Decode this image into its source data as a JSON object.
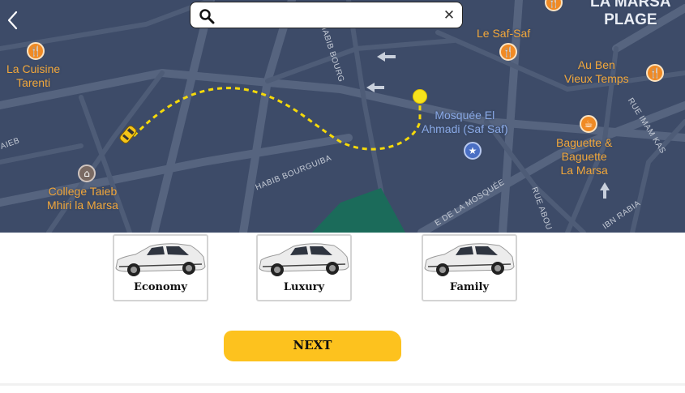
{
  "search": {
    "placeholder": "",
    "value": ""
  },
  "map": {
    "places": [
      {
        "id": "la-marsa-plage",
        "text": "LA MARSA\nPLAGE"
      },
      {
        "id": "le-saf-saf",
        "text": "Le Saf-Saf"
      },
      {
        "id": "la-cuisine-tarenti",
        "text": "La Cuisine\nTarenti"
      },
      {
        "id": "au-ben-vieux-temps",
        "text": "Au Ben\nVieux Temps"
      },
      {
        "id": "mosquee-el-ahmadi",
        "text": "Mosquée El\nAhmadi (Saf Saf)"
      },
      {
        "id": "baguette-baguette",
        "text": "Baguette &\nBaguette\nLa Marsa"
      },
      {
        "id": "college-taieb",
        "text": "College Taieb\nMhiri la Marsa"
      }
    ],
    "streets": {
      "habib_bourguiba": "HABIB BOURGUIBA",
      "de_la_mosquee": "E DE LA MOSQUÉE",
      "rue_abou": "RUE ABOU",
      "rue_ibn_rabia": "IBN RABIA",
      "rue_imam_kas": "RUE IMAM KAS",
      "habib_bourg_top": "HABIB BOURG",
      "taieb": "AIEB"
    }
  },
  "car_options": [
    {
      "label": "Economy"
    },
    {
      "label": "Luxury"
    },
    {
      "label": "Family"
    }
  ],
  "next_button": {
    "label": "NEXT"
  },
  "colors": {
    "map_bg": "#3b4a66",
    "accent": "#fdc21e",
    "route": "#f5d90a",
    "poi_label": "#f2a73b"
  }
}
